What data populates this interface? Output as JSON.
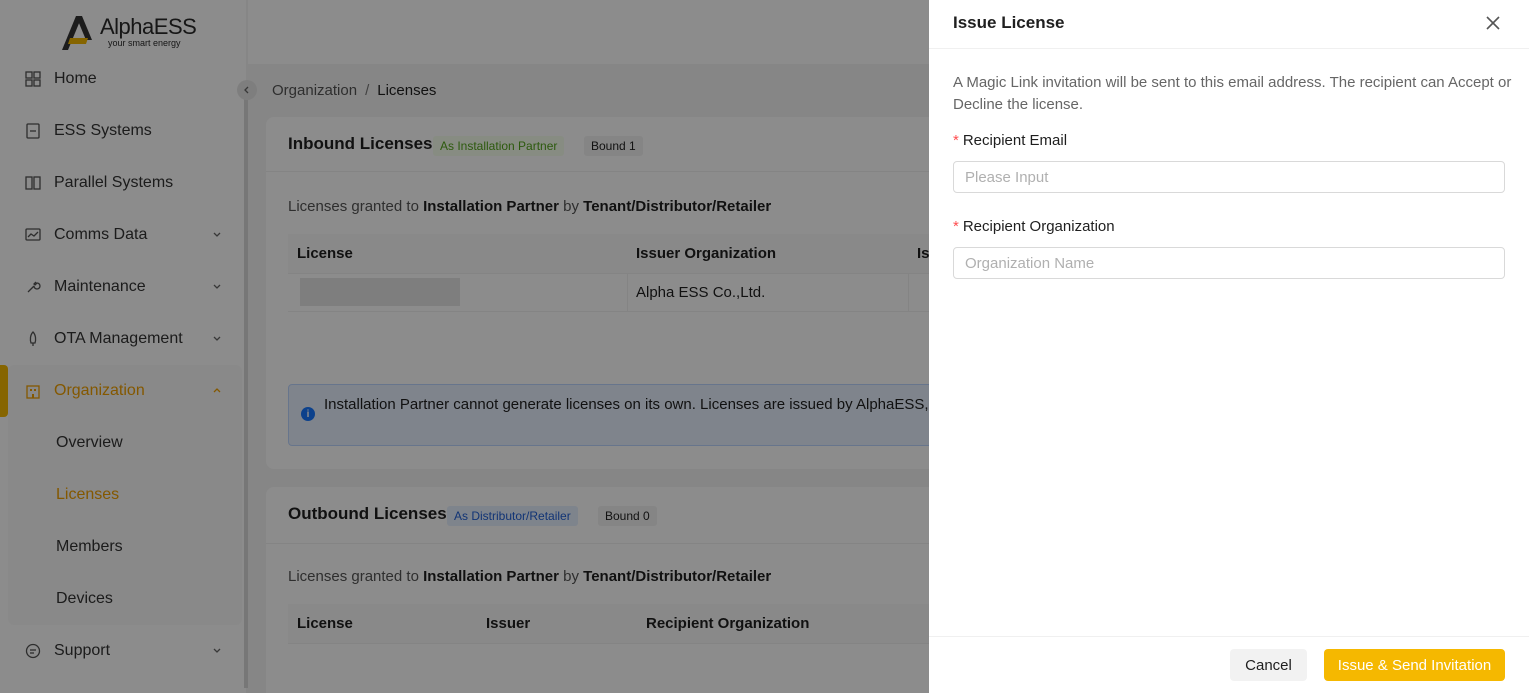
{
  "brand": {
    "name": "AlphaESS",
    "tagline": "your smart energy"
  },
  "sidebar": {
    "items": [
      {
        "label": "Home",
        "icon": "home-icon"
      },
      {
        "label": "ESS Systems",
        "icon": "ess-icon"
      },
      {
        "label": "Parallel Systems",
        "icon": "parallel-icon"
      },
      {
        "label": "Comms Data",
        "icon": "comms-icon"
      },
      {
        "label": "Maintenance",
        "icon": "wrench-icon"
      },
      {
        "label": "OTA Management",
        "icon": "rocket-icon"
      },
      {
        "label": "Organization",
        "icon": "building-icon"
      },
      {
        "label": "Support",
        "icon": "support-icon"
      }
    ],
    "org_sub": [
      "Overview",
      "Licenses",
      "Members",
      "Devices"
    ],
    "active": "Organization",
    "active_sub": "Licenses"
  },
  "breadcrumb": {
    "parent": "Organization",
    "sep": "/",
    "current": "Licenses"
  },
  "inbound": {
    "title": "Inbound Licenses",
    "tag_role": "As Installation Partner",
    "tag_bound": "Bound 1",
    "desc_pre": "Licenses granted to ",
    "desc_b1": "Installation Partner",
    "desc_mid": " by ",
    "desc_b2": "Tenant/Distributor/Retailer",
    "headers": [
      "License",
      "Issuer Organization",
      "Is"
    ],
    "row": {
      "issuer": "Alpha ESS Co.,Ltd."
    },
    "alert_text": "Installation Partner cannot generate licenses on its own. Licenses are issued by AlphaESS, D existing license number to be used."
  },
  "outbound": {
    "title": "Outbound Licenses",
    "tag_role": "As Distributor/Retailer",
    "tag_bound": "Bound 0",
    "desc_pre": "Licenses granted to ",
    "desc_b1": "Installation Partner",
    "desc_mid": " by ",
    "desc_b2": "Tenant/Distributor/Retailer",
    "headers": [
      "License",
      "Issuer",
      "Recipient Organization"
    ]
  },
  "drawer": {
    "title": "Issue License",
    "description": "A Magic Link invitation will be sent to this email address. The recipient can Accept or Decline the license.",
    "email_label": "Recipient Email",
    "email_placeholder": "Please Input",
    "email_value": "",
    "org_label": "Recipient Organization",
    "org_placeholder": "Organization Name",
    "org_value": "",
    "required_mark": "*",
    "cancel": "Cancel",
    "submit": "Issue & Send Invitation"
  },
  "colors": {
    "accent": "#f5b800",
    "active_text": "#f0a000",
    "info": "#1677ff"
  }
}
